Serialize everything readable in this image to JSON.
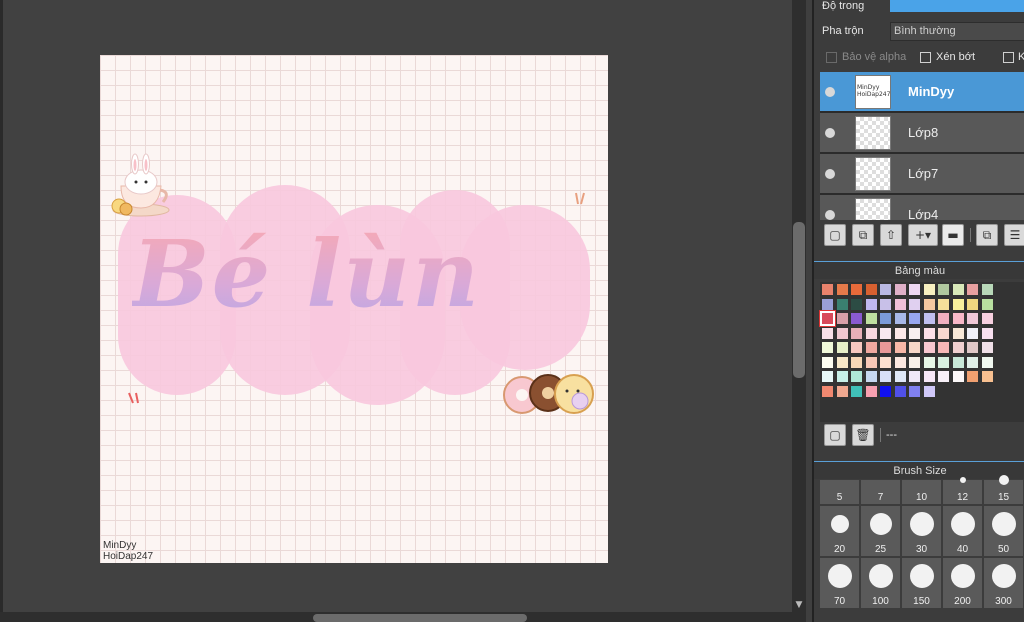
{
  "panel": {
    "opacity_label": "Độ trong",
    "blend_label": "Pha trộn",
    "blend_value": "Bình thường",
    "protect_alpha_label": "Bảo vệ alpha",
    "clip_label": "Xén bớt",
    "extra_label": "K"
  },
  "layers": [
    {
      "name": "MinDyy",
      "selected": true,
      "thumb_text": "MinDyy HoiDap247"
    },
    {
      "name": "Lớp8",
      "selected": false
    },
    {
      "name": "Lớp7",
      "selected": false
    },
    {
      "name": "Lớp4",
      "selected": false
    }
  ],
  "layer_toolbar": {
    "icons": [
      "new-layer-icon",
      "duplicate-layer-icon",
      "import-layer-icon",
      "add-layer-menu-icon",
      "folder-icon",
      "merge-icon",
      "layer-settings-icon"
    ]
  },
  "palette": {
    "title": "Bảng màu",
    "name": "---",
    "colors": [
      [
        "#e8826c",
        "#e67a4a",
        "#e86a3a",
        "#d86030",
        "#b9b8e2",
        "#e0b0c8",
        "#eed8f2",
        "#f8f0c0",
        "#b0c89e",
        "#d8e8b8",
        "#e8a0a0",
        "#b8d8b8"
      ],
      [
        "#9aa0d8",
        "#3a8070",
        "#2c4c44",
        "#c0b8f0",
        "#c8c0e8",
        "#f0c0d8",
        "#e0d0f0",
        "#f6c8a0",
        "#f6e09a",
        "#f8f09c",
        "#f0d880",
        "#b8e0a0"
      ],
      [
        "#d84a5a",
        "#d8a0a8",
        "#8a5ad0",
        "#c0e0a0",
        "#7a9ad8",
        "#a8b8e8",
        "#98a8f0",
        "#c0c0f0",
        "#f0b0c0",
        "#f8b8c8",
        "#f0c8d8",
        "#f8d0e0"
      ],
      [
        "#f8e0e8",
        "#f0c8d0",
        "#e8b0b8",
        "#f8d8e0",
        "#f8e8f0",
        "#fce8e8",
        "#f8f0f0",
        "#fce0e8",
        "#f8d8d0",
        "#f8e8d8",
        "#f0f0f8",
        "#f8e0f0"
      ],
      [
        "#f0f8d8",
        "#e8f0c8",
        "#f8c8c0",
        "#f0a8a0",
        "#e89898",
        "#f8b8a8",
        "#f8d8c8",
        "#f8c8d0",
        "#f8b8b8",
        "#f0d0d0",
        "#e0c8c8",
        "#f0e0e8"
      ],
      [
        "#fcfcf0",
        "#f8e8c8",
        "#f8d8b8",
        "#f8c8b8",
        "#fce0d0",
        "#fce8e0",
        "#f8f0e8",
        "#e8f8e8",
        "#d8f0e0",
        "#c8e8d8",
        "#e0f0e8",
        "#f0f8f0"
      ],
      [
        "#e8f8f8",
        "#c8f0e8",
        "#b0e8d8",
        "#c8d8f0",
        "#d8e0f8",
        "#e0e8f8",
        "#f0e8f8",
        "#f8e8f8",
        "#f8f0f8",
        "#fcf8f8",
        "#f0a070",
        "#f8c090"
      ],
      [
        "#f08870",
        "#f0a890",
        "#40c0b8",
        "#f8a0b0",
        "#1010f0",
        "#5050e8",
        "#8080f0",
        "#d0c8f8"
      ]
    ]
  },
  "brush": {
    "title": "Brush Size",
    "sizes_row0": [
      "5",
      "7",
      "10",
      "12",
      "15"
    ],
    "sizes_row1": [
      "20",
      "25",
      "30",
      "40",
      "50"
    ],
    "sizes_row2": [
      "70",
      "100",
      "150",
      "200",
      "300"
    ]
  },
  "canvas": {
    "title_text": "Bé lùn",
    "watermark_line1": "MinDyy",
    "watermark_line2": "HoiDap247"
  }
}
